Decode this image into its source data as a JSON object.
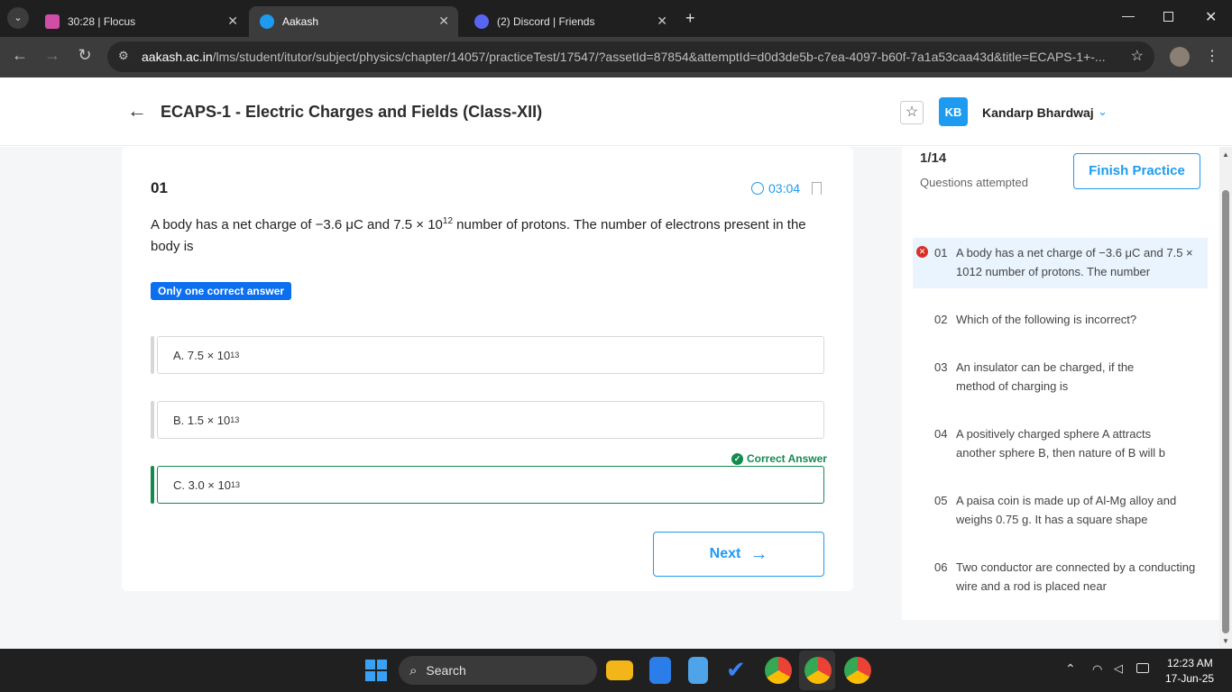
{
  "browser": {
    "tabs": [
      {
        "title": "30:28 | Flocus",
        "active": false
      },
      {
        "title": "Aakash",
        "active": true
      },
      {
        "title": "(2) Discord | Friends",
        "active": false
      }
    ],
    "url_host": "aakash.ac.in",
    "url_path": "/lms/student/itutor/subject/physics/chapter/14057/practiceTest/17547/?assetId=87854&attemptId=d0d3de5b-c7ea-4097-b60f-7a1a53caa43d&title=ECAPS-1+-..."
  },
  "header": {
    "title": "ECAPS-1 - Electric Charges and Fields (Class-XII)",
    "avatar_initials": "KB",
    "user_name": "Kandarp Bhardwaj"
  },
  "question": {
    "number": "01",
    "timer": "03:04",
    "text_part1": "A body has a net charge of −3.6 μC and 7.5 × 10",
    "text_exp": "12",
    "text_part2": " number of protons. The number of electrons present in the body is",
    "type_badge": "Only one correct answer",
    "correct_label": "Correct Answer",
    "options": [
      {
        "prefix": "A. 7.5 × 10",
        "exp": "13"
      },
      {
        "prefix": "B. 1.5 × 10",
        "exp": "13"
      },
      {
        "prefix": "C. 3.0 × 10",
        "exp": "13"
      }
    ],
    "next_label": "Next"
  },
  "side": {
    "progress": "1/14",
    "progress_label": "Questions attempted",
    "finish_label": "Finish Practice",
    "items": [
      {
        "num": "01",
        "text": "A body has a net charge of −3.6 μC and 7.5 × 1012 number of protons. The number"
      },
      {
        "num": "02",
        "text": "Which of the following is incorrect?"
      },
      {
        "num": "03",
        "text": "An insulator can be charged, if the method of charging is"
      },
      {
        "num": "04",
        "text": "A positively charged sphere A attracts another sphere B, then nature of B will b"
      },
      {
        "num": "05",
        "text": "A paisa coin is made up of Al-Mg alloy and weighs 0.75 g. It has a square shape"
      },
      {
        "num": "06",
        "text": "Two conductor are connected by a conducting wire and a rod is placed near"
      }
    ]
  },
  "taskbar": {
    "search_placeholder": "Search",
    "time": "12:23 AM",
    "date": "17-Jun-25"
  },
  "colors": {
    "accent": "#1d9bf0",
    "correct": "#148a4f",
    "wrong": "#d93025",
    "badge": "#0b6ff0"
  }
}
